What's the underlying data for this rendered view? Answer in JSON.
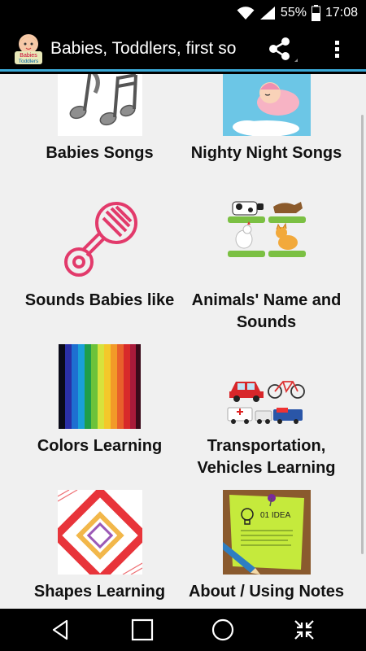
{
  "status_bar": {
    "battery_percent": "55%",
    "time": "17:08",
    "icons": [
      "wifi-icon",
      "signal-icon",
      "battery-icon"
    ]
  },
  "app_bar": {
    "logo_text_1": "Babies",
    "logo_text_2": "Toddlers",
    "title": "Babies, Toddlers, first so",
    "actions": [
      "share-icon",
      "overflow-menu-icon"
    ]
  },
  "tiles": [
    {
      "label": "Babies Songs",
      "icon": "music-notes-icon"
    },
    {
      "label": "Nighty Night Songs",
      "icon": "sleeping-baby-moon-icon"
    },
    {
      "label": "Sounds Babies like",
      "icon": "baby-rattle-icon"
    },
    {
      "label": "Animals' Name and Sounds",
      "icon": "farm-animals-icon"
    },
    {
      "label": "Colors Learning",
      "icon": "color-stripes-icon"
    },
    {
      "label": "Transportation, Vehicles Learning",
      "icon": "vehicles-icon"
    },
    {
      "label": "Shapes Learning",
      "icon": "shapes-icon"
    },
    {
      "label": "About / Using Notes",
      "icon": "idea-note-icon"
    },
    {
      "label": "01 IDEA",
      "icon": "note-caption"
    }
  ],
  "nav_bar": {
    "buttons": [
      "back-icon",
      "home-icon",
      "recents-icon",
      "fullscreen-icon"
    ]
  },
  "colors": {
    "accent": "#3aa9d6",
    "background": "#f0f0f0",
    "bar": "#000000"
  }
}
